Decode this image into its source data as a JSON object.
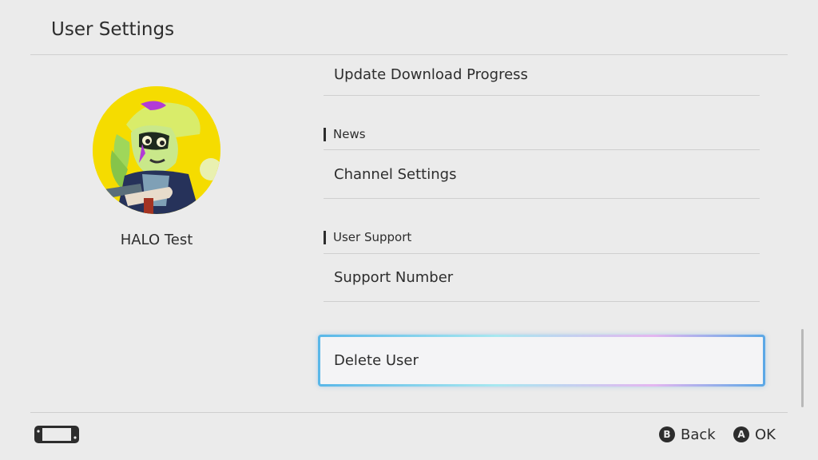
{
  "header": {
    "title": "User Settings"
  },
  "profile": {
    "name": "HALO Test"
  },
  "list": {
    "update_download_progress": "Update Download Progress",
    "news_section": "News",
    "channel_settings": "Channel Settings",
    "user_support_section": "User Support",
    "support_number": "Support Number",
    "delete_user": "Delete User"
  },
  "footer": {
    "back_key": "B",
    "back_label": "Back",
    "ok_key": "A",
    "ok_label": "OK"
  },
  "colors": {
    "background": "#ebebeb",
    "text": "#2d2d2d",
    "focus_gradient": [
      "#59b7e8",
      "#a8e8f0",
      "#e4b6f0"
    ],
    "avatar_bg": "#f5dc00"
  },
  "icons": {
    "console": "handheld-console-icon",
    "back": "b-button-icon",
    "ok": "a-button-icon"
  }
}
